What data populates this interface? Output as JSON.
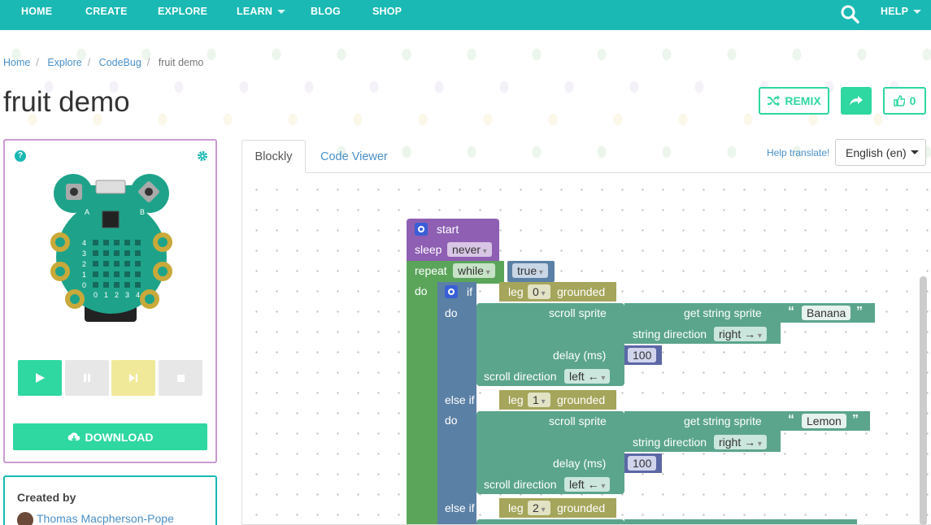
{
  "nav": {
    "items": [
      {
        "label": "HOME",
        "has_caret": false
      },
      {
        "label": "CREATE",
        "has_caret": false
      },
      {
        "label": "EXPLORE",
        "has_caret": false
      },
      {
        "label": "LEARN",
        "has_caret": true
      },
      {
        "label": "BLOG",
        "has_caret": false
      },
      {
        "label": "SHOP",
        "has_caret": false
      }
    ],
    "help": "HELP",
    "search_icon": "search-icon",
    "color": "#1ab9b3"
  },
  "breadcrumb": [
    "Home",
    "Explore",
    "CodeBug",
    "fruit demo"
  ],
  "title": "fruit demo",
  "actions": {
    "remix": "REMIX",
    "likes": "0",
    "accent": "#2fd7a1"
  },
  "device": {
    "button_a": "A",
    "button_b": "B",
    "row_labels": [
      "4",
      "3",
      "2",
      "1",
      "0"
    ],
    "col_labels": [
      "0",
      "1",
      "2",
      "3",
      "4"
    ],
    "controls": [
      "play-icon",
      "pause-icon",
      "step-icon",
      "stop-icon"
    ],
    "download": "DOWNLOAD"
  },
  "creator": {
    "label": "Created by",
    "name": "Thomas Macpherson-Pope"
  },
  "tabs": [
    "Blockly",
    "Code Viewer"
  ],
  "help_translate": "Help translate!",
  "language": "English (en)",
  "blocks": {
    "start": "start",
    "sleep": "sleep",
    "sleep_value": "never",
    "repeat": "repeat",
    "repeat_mode": "while",
    "repeat_cond": "true",
    "do": "do",
    "if": "if",
    "else_if": "else if",
    "leg": "leg",
    "grounded": "grounded",
    "scroll_sprite": "scroll sprite",
    "get_string_sprite": "get string sprite",
    "string_direction": "string direction",
    "delay": "delay (ms)",
    "scroll_direction": "scroll direction",
    "branches": [
      {
        "leg": "0",
        "text": "Banana",
        "str_dir": "right →",
        "delay": "100",
        "scroll_dir": "left ←"
      },
      {
        "leg": "1",
        "text": "Lemon",
        "str_dir": "right →",
        "delay": "100",
        "scroll_dir": "left ←"
      },
      {
        "leg": "2"
      }
    ]
  }
}
